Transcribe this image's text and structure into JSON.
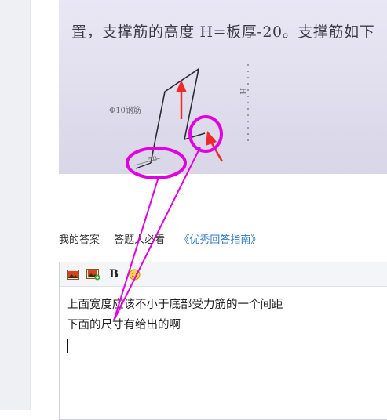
{
  "photo": {
    "text": "置，支撑筋的高度 H=板厚-20。支撑筋如下",
    "label_rebar": "Φ10钢筋",
    "label_h": "H",
    "label_50": "50"
  },
  "tabs": {
    "my_answer": "我的答案",
    "must_read": "答题人必看",
    "guide_link": "《优秀回答指南》"
  },
  "editor": {
    "toolbar": {
      "image_icon": "image-icon",
      "upload_icon": "image-upload-icon",
      "bold_label": "B",
      "emoji_icon": "emoji-icon"
    },
    "lines": [
      "上面宽度应该不小于底部受力筋的一个间距",
      "下面的尺寸有给出的啊"
    ]
  },
  "annotation_colors": {
    "magenta": "#e000e0",
    "red_arrow": "#ee2a2a"
  }
}
